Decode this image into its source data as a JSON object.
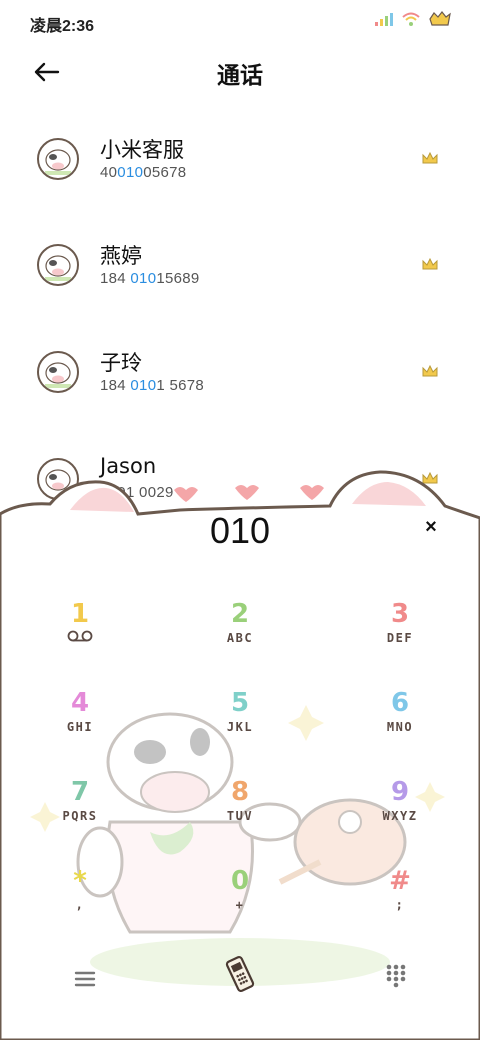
{
  "status_bar": {
    "time": "凌晨2:36"
  },
  "header": {
    "title": "通话"
  },
  "contacts": [
    {
      "name": "小米客服",
      "number_pre": "40",
      "number_match": "010",
      "number_post": "05678"
    },
    {
      "name": "燕婷",
      "number_pre": "184 ",
      "number_match": "010",
      "number_post": "15689"
    },
    {
      "name": "子玲",
      "number_pre": "184 ",
      "number_match": "010",
      "number_post": "1 5678"
    },
    {
      "name": "Jason",
      "number_pre": "",
      "number_match": "01",
      "number_post": "01 0029"
    }
  ],
  "dialer": {
    "display": "010",
    "clear_label": "×"
  },
  "keys": [
    {
      "digit": "1",
      "letters": "",
      "color": "#f2c94c"
    },
    {
      "digit": "2",
      "letters": "ABC",
      "color": "#9ad07a"
    },
    {
      "digit": "3",
      "letters": "DEF",
      "color": "#f08a8a"
    },
    {
      "digit": "4",
      "letters": "GHI",
      "color": "#e48ad8"
    },
    {
      "digit": "5",
      "letters": "JKL",
      "color": "#7fd0c9"
    },
    {
      "digit": "6",
      "letters": "MNO",
      "color": "#7fc7e8"
    },
    {
      "digit": "7",
      "letters": "PQRS",
      "color": "#7fc7a8"
    },
    {
      "digit": "8",
      "letters": "TUV",
      "color": "#f0a66c"
    },
    {
      "digit": "9",
      "letters": "WXYZ",
      "color": "#b59ae8"
    },
    {
      "digit": "*",
      "letters": ",",
      "color": "#e8d84c"
    },
    {
      "digit": "0",
      "letters": "+",
      "color": "#9ad07a"
    },
    {
      "digit": "#",
      "letters": ";",
      "color": "#f08a8a"
    }
  ],
  "icons": {
    "back": "arrow-left-icon",
    "menu": "menu-icon",
    "call": "phone-handset-icon",
    "keypad": "dialpad-icon"
  }
}
